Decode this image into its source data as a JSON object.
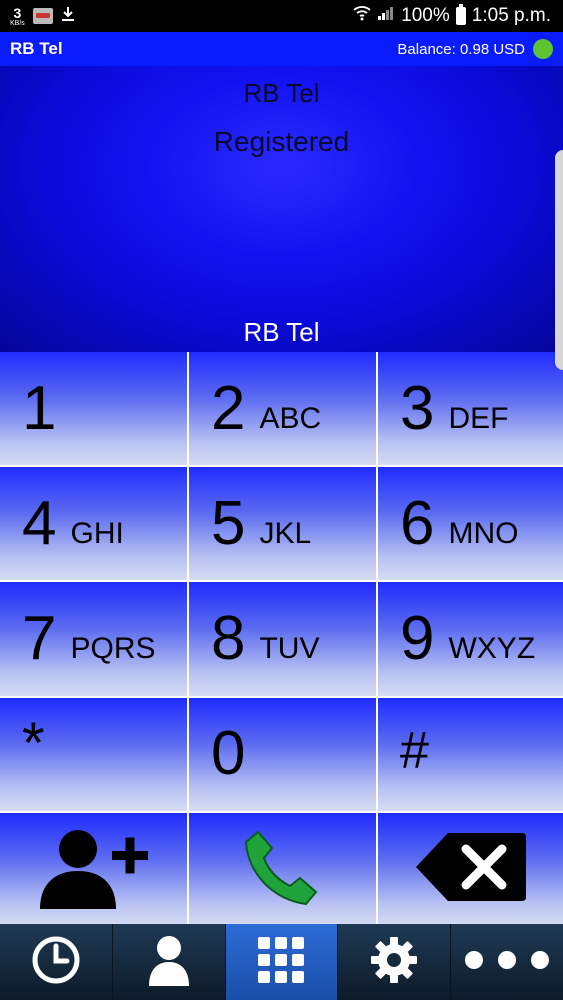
{
  "statusbar": {
    "speed_value": "3",
    "speed_unit": "KB/s",
    "battery": "100%",
    "time": "1:05 p.m."
  },
  "header": {
    "app_title": "RB Tel",
    "balance": "Balance: 0.98 USD",
    "status_color": "#5cc331"
  },
  "display": {
    "provider": "RB Tel",
    "registration": "Registered",
    "number_line": "RB Tel"
  },
  "keypad": {
    "keys": [
      {
        "digit": "1",
        "letters": ""
      },
      {
        "digit": "2",
        "letters": "ABC"
      },
      {
        "digit": "3",
        "letters": "DEF"
      },
      {
        "digit": "4",
        "letters": "GHI"
      },
      {
        "digit": "5",
        "letters": "JKL"
      },
      {
        "digit": "6",
        "letters": "MNO"
      },
      {
        "digit": "7",
        "letters": "PQRS"
      },
      {
        "digit": "8",
        "letters": "TUV"
      },
      {
        "digit": "9",
        "letters": "WXYZ"
      },
      {
        "digit": "*",
        "letters": ""
      },
      {
        "digit": "0",
        "letters": ""
      },
      {
        "digit": "#",
        "letters": ""
      }
    ],
    "actions": [
      "add-contact-icon",
      "call-icon",
      "backspace-icon"
    ]
  },
  "bottomnav": {
    "items": [
      "clock-icon",
      "contacts-icon",
      "dialpad-icon",
      "settings-icon",
      "more-icon"
    ],
    "active_index": 2
  },
  "colors": {
    "accent": "#0a1bff",
    "call_green": "#1fa33a"
  }
}
